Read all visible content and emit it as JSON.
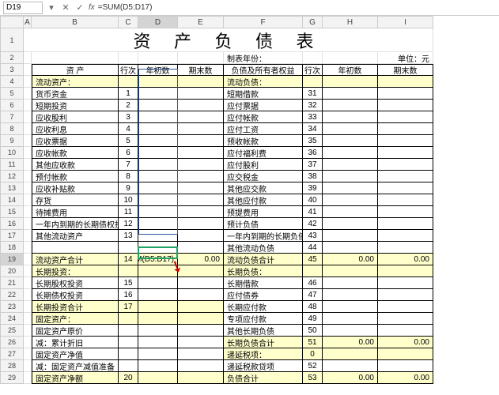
{
  "namebox": "D19",
  "formula": "=SUM(D5:D17)",
  "fx_label": "fx",
  "cols": [
    "A",
    "B",
    "C",
    "D",
    "E",
    "F",
    "G",
    "H",
    "I"
  ],
  "title": "资 产 负 债 表",
  "meta": {
    "left": "制表年份：",
    "right": "单位：元"
  },
  "headers": {
    "asset": "资 产",
    "seq": "行次",
    "begin": "年初数",
    "end": "期末数",
    "liab": "负债及所有者权益"
  },
  "rows": [
    {
      "n": 4,
      "b": "流动资产：",
      "c": "",
      "f": "流动负债：",
      "g": "",
      "yl": true,
      "yr": true
    },
    {
      "n": 5,
      "b": "货币资金",
      "c": "1",
      "f": "短期借款",
      "g": "31"
    },
    {
      "n": 6,
      "b": "短期投资",
      "c": "2",
      "f": "应付票据",
      "g": "32"
    },
    {
      "n": 7,
      "b": "应收股利",
      "c": "3",
      "f": "应付帐款",
      "g": "33"
    },
    {
      "n": 8,
      "b": "应收利息",
      "c": "4",
      "f": "应付工资",
      "g": "34"
    },
    {
      "n": 9,
      "b": "应收票据",
      "c": "5",
      "f": "预收帐款",
      "g": "35"
    },
    {
      "n": 10,
      "b": "应收帐款",
      "c": "6",
      "f": "应付福利费",
      "g": "36"
    },
    {
      "n": 11,
      "b": "其他应收款",
      "c": "7",
      "f": "应付股利",
      "g": "37"
    },
    {
      "n": 12,
      "b": "预付帐款",
      "c": "8",
      "f": "应交税金",
      "g": "38"
    },
    {
      "n": 13,
      "b": "应收补贴款",
      "c": "9",
      "f": "其他应交款",
      "g": "39"
    },
    {
      "n": 14,
      "b": "存货",
      "c": "10",
      "f": "其他应付款",
      "g": "40"
    },
    {
      "n": 15,
      "b": "待摊费用",
      "c": "11",
      "f": "预提费用",
      "g": "41"
    },
    {
      "n": 16,
      "b": "一年内到期的长期债权投资",
      "c": "12",
      "f": "预计负债",
      "g": "42"
    },
    {
      "n": 17,
      "b": "其他流动资产",
      "c": "13",
      "f": "一年内到期的长期负债",
      "g": "43"
    },
    {
      "n": 18,
      "b": "",
      "c": "",
      "f": "其他流动负债",
      "g": "44"
    },
    {
      "n": 19,
      "b": "流动资产合计",
      "c": "14",
      "d": "=SUM(D5:D17)",
      "e": "0.00",
      "f": "流动负债合计",
      "g": "45",
      "h": "0.00",
      "i": "0.00",
      "yl": true,
      "yr": true
    },
    {
      "n": 20,
      "b": "长期投资：",
      "c": "",
      "f": "长期负债：",
      "g": "",
      "yl": true,
      "yr": true
    },
    {
      "n": 21,
      "b": "长期股权投资",
      "c": "15",
      "f": "长期借款",
      "g": "46"
    },
    {
      "n": 22,
      "b": "长期债权投资",
      "c": "16",
      "f": "应付债券",
      "g": "47"
    },
    {
      "n": 23,
      "b": "长期投资合计",
      "c": "17",
      "f": "长期应付款",
      "g": "48",
      "yl": true
    },
    {
      "n": 24,
      "b": "固定资产：",
      "c": "",
      "f": "专项应付款",
      "g": "49",
      "yl": true
    },
    {
      "n": 25,
      "b": "固定资产原价",
      "c": "",
      "f": "其他长期负债",
      "g": "50"
    },
    {
      "n": 26,
      "b": "减：累计折旧",
      "c": "",
      "f": "长期负债合计",
      "g": "51",
      "h": "0.00",
      "i": "0.00",
      "yr": true
    },
    {
      "n": 27,
      "b": "固定资产净值",
      "c": "",
      "f": "递延税项：",
      "g": "0",
      "yr": true
    },
    {
      "n": 28,
      "b": "减：固定资产减值准备",
      "c": "",
      "f": "递延税款贷项",
      "g": "52"
    },
    {
      "n": 29,
      "b": "固定资产净额",
      "c": "20",
      "f": "负债合计",
      "g": "53",
      "h": "0.00",
      "i": "0.00",
      "yl": true,
      "yr": true
    }
  ],
  "selected_cell_formula": "=SUM(D5:D17)"
}
